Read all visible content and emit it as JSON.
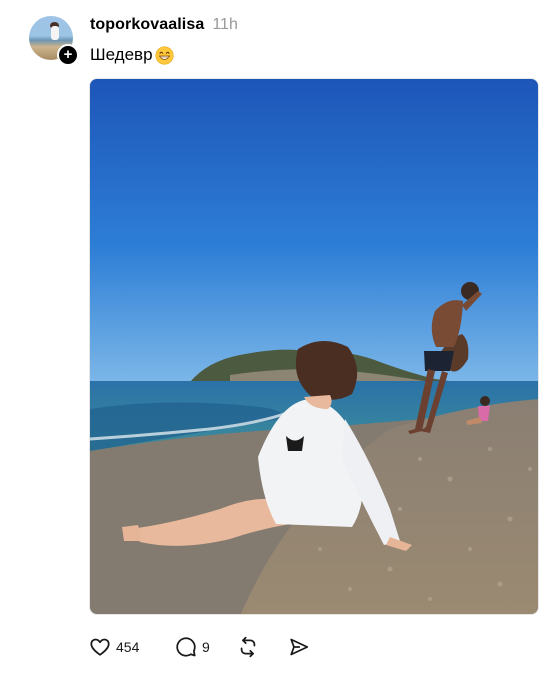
{
  "post": {
    "username": "toporkovaalisa",
    "time": "11h",
    "caption": "Шедевр",
    "caption_emoji_icon": "grinning-face-emoji",
    "follow_badge": "+",
    "photo_icon": "beach-photo",
    "likes": "454",
    "replies": "9"
  },
  "icons": {
    "like": "heart-icon",
    "reply": "comment-icon",
    "repost": "repost-icon",
    "share": "send-icon"
  }
}
